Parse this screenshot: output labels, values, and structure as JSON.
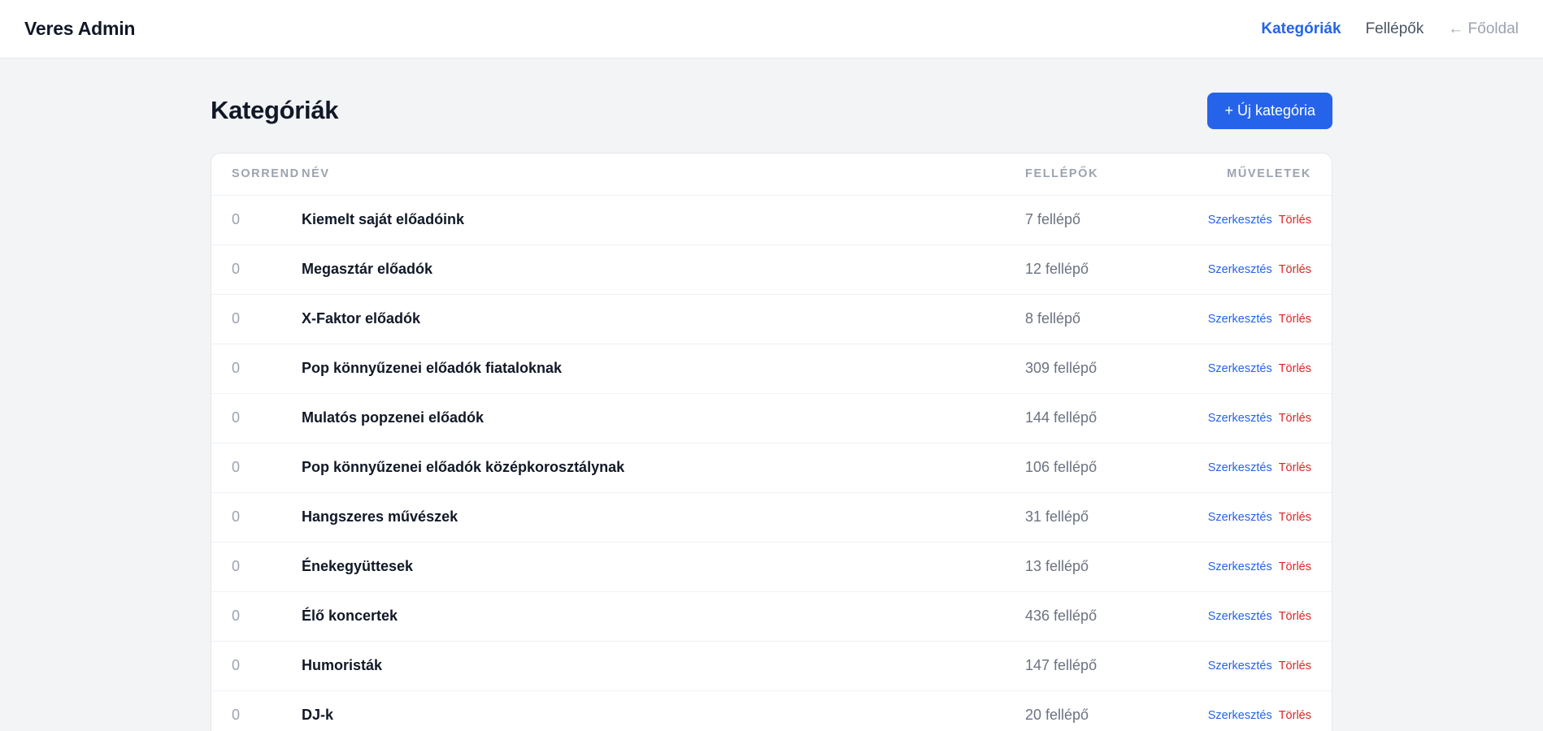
{
  "brand": "Veres Admin",
  "nav": {
    "categories": "Kategóriák",
    "performers": "Fellépők",
    "home": "← Főoldal"
  },
  "page": {
    "title": "Kategóriák",
    "new_button": "+ Új kategória"
  },
  "table": {
    "headers": {
      "order": "Sorrend",
      "name": "Név",
      "performers": "Fellépők",
      "actions": "Műveletek"
    },
    "actions": {
      "edit": "Szerkesztés",
      "delete": "Törlés"
    },
    "rows": [
      {
        "order": "0",
        "name": "Kiemelt saját előadóink",
        "count": "7 fellépő"
      },
      {
        "order": "0",
        "name": "Megasztár előadók",
        "count": "12 fellépő"
      },
      {
        "order": "0",
        "name": "X-Faktor előadók",
        "count": "8 fellépő"
      },
      {
        "order": "0",
        "name": "Pop könnyűzenei előadók fiataloknak",
        "count": "309 fellépő"
      },
      {
        "order": "0",
        "name": "Mulatós popzenei előadók",
        "count": "144 fellépő"
      },
      {
        "order": "0",
        "name": "Pop könnyűzenei előadók középkorosztálynak",
        "count": "106 fellépő"
      },
      {
        "order": "0",
        "name": "Hangszeres művészek",
        "count": "31 fellépő"
      },
      {
        "order": "0",
        "name": "Énekegyüttesek",
        "count": "13 fellépő"
      },
      {
        "order": "0",
        "name": "Élő koncertek",
        "count": "436 fellépő"
      },
      {
        "order": "0",
        "name": "Humoristák",
        "count": "147 fellépő"
      },
      {
        "order": "0",
        "name": "DJ-k",
        "count": "20 fellépő"
      }
    ]
  },
  "colors": {
    "accent": "#2563eb",
    "danger": "#dc2626",
    "background": "#f3f4f6"
  }
}
